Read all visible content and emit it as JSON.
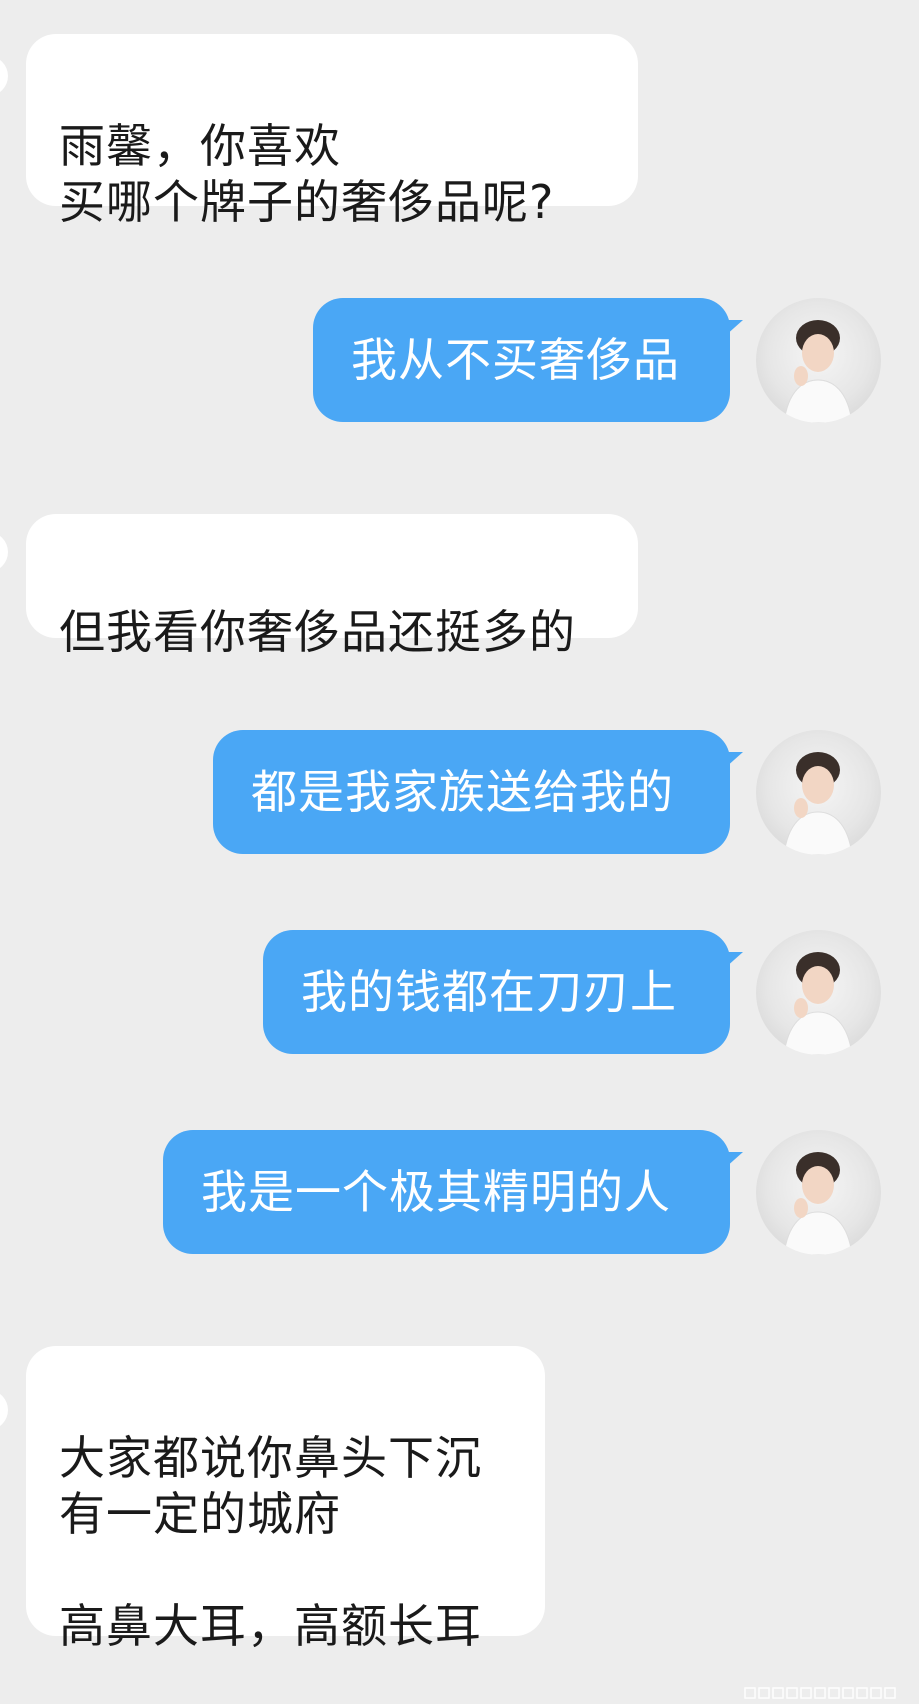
{
  "chat": {
    "messages": [
      {
        "side": "in",
        "text": "雨馨，你喜欢\n买哪个牌子的奢侈品呢?"
      },
      {
        "side": "out",
        "text": "我从不买奢侈品"
      },
      {
        "side": "in",
        "text": "但我看你奢侈品还挺多的"
      },
      {
        "side": "out",
        "text": "都是我家族送给我的"
      },
      {
        "side": "out",
        "text": "我的钱都在刀刃上"
      },
      {
        "side": "out",
        "text": "我是一个极其精明的人"
      },
      {
        "side": "in",
        "text": "大家都说你鼻头下沉\n有一定的城府\n\n高鼻大耳，高额长耳"
      }
    ]
  },
  "colors": {
    "background": "#ededed",
    "incoming_bubble": "#ffffff",
    "outgoing_bubble": "#4aa7f5"
  },
  "icons": {
    "avatar": "user-avatar-photo",
    "watermark": "watermark-icon"
  }
}
